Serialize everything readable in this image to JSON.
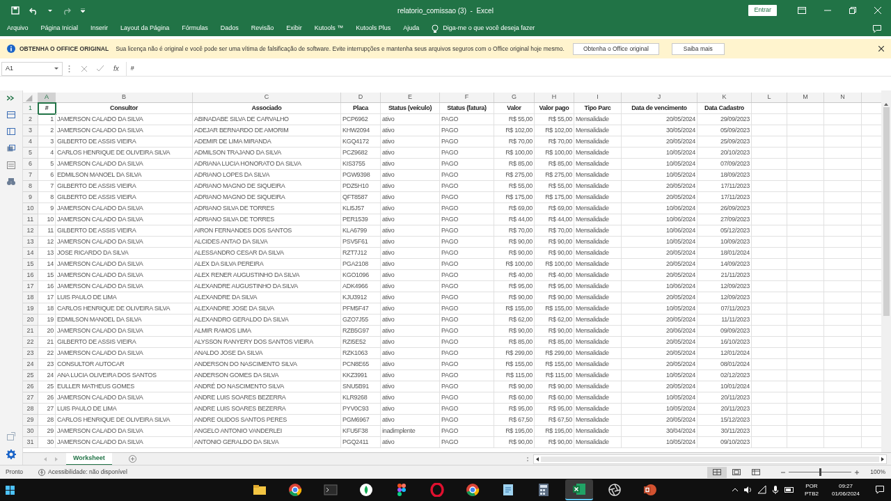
{
  "title_bar": {
    "title": "relatorio_comissao (3)  -  Excel",
    "sign_in": "Entrar"
  },
  "ribbon_tabs": [
    "Arquivo",
    "Página Inicial",
    "Inserir",
    "Layout da Página",
    "Fórmulas",
    "Dados",
    "Revisão",
    "Exibir",
    "Kutools ™",
    "Kutools Plus",
    "Ajuda"
  ],
  "tell_me": "Diga-me o que você deseja fazer",
  "notice": {
    "title": "OBTENHA O OFFICE ORIGINAL",
    "message": "Sua licença não é original e você pode ser uma vítima de falsificação de software. Evite interrupções e mantenha seus arquivos seguros com o Office original hoje mesmo.",
    "buttons": [
      "Obtenha o Office original",
      "Saiba mais"
    ]
  },
  "formula_bar": {
    "name_box": "A1",
    "fx": "fx",
    "content": "#"
  },
  "sheet": {
    "columns": [
      "A",
      "B",
      "C",
      "D",
      "E",
      "F",
      "G",
      "H",
      "I",
      "J",
      "K",
      "L",
      "M",
      "N"
    ],
    "header_row": {
      "number": "1",
      "cells": [
        "#",
        "Consultor",
        "Associado",
        "Placa",
        "Status (veículo)",
        "Status (fatura)",
        "Valor",
        "Valor pago",
        "Tipo Parc",
        "Data de vencimento",
        "Data Cadastro"
      ]
    },
    "rows": [
      {
        "number": "2",
        "cells": [
          "1",
          "JAMERSON CALADO DA SILVA",
          "ABINADABE SILVA DE CARVALHO",
          "PCP6962",
          "ativo",
          "PAGO",
          "R$ 55,00",
          "R$ 55,00",
          "Mensalidade",
          "20/05/2024",
          "29/09/2023"
        ]
      },
      {
        "number": "3",
        "cells": [
          "2",
          "JAMERSON CALADO DA SILVA",
          "ADEJAR BERNARDO DE AMORIM",
          "KHW2094",
          "ativo",
          "PAGO",
          "R$ 102,00",
          "R$ 102,00",
          "Mensalidade",
          "30/05/2024",
          "05/09/2023"
        ]
      },
      {
        "number": "4",
        "cells": [
          "3",
          "GILBERTO DE ASSIS VIEIRA",
          "ADEMIR DE LIMA MIRANDA",
          "KGQ4172",
          "ativo",
          "PAGO",
          "R$ 70,00",
          "R$ 70,00",
          "Mensalidade",
          "20/05/2024",
          "25/09/2023"
        ]
      },
      {
        "number": "5",
        "cells": [
          "4",
          "CARLOS HENRIQUE DE OLIVEIRA SILVA",
          "ADMILSON TRAJANO DA SILVA",
          "PCZ9682",
          "ativo",
          "PAGO",
          "R$ 100,00",
          "R$ 100,00",
          "Mensalidade",
          "10/05/2024",
          "20/10/2023"
        ]
      },
      {
        "number": "6",
        "cells": [
          "5",
          "JAMERSON CALADO DA SILVA",
          "ADRIANA LUCIA HONORATO DA SILVA",
          "KIS3755",
          "ativo",
          "PAGO",
          "R$ 85,00",
          "R$ 85,00",
          "Mensalidade",
          "10/05/2024",
          "07/09/2023"
        ]
      },
      {
        "number": "7",
        "cells": [
          "6",
          "EDMILSON MANOEL DA SILVA",
          "ADRIANO LOPES DA SILVA",
          "PGW9398",
          "ativo",
          "PAGO",
          "R$ 275,00",
          "R$ 275,00",
          "Mensalidade",
          "10/05/2024",
          "18/09/2023"
        ]
      },
      {
        "number": "8",
        "cells": [
          "7",
          "GILBERTO DE ASSIS VIEIRA",
          "ADRIANO MAGNO DE SIQUEIRA",
          "PDZ5H10",
          "ativo",
          "PAGO",
          "R$ 55,00",
          "R$ 55,00",
          "Mensalidade",
          "20/05/2024",
          "17/11/2023"
        ]
      },
      {
        "number": "9",
        "cells": [
          "8",
          "GILBERTO DE ASSIS VIEIRA",
          "ADRIANO MAGNO DE SIQUEIRA",
          "QFT8587",
          "ativo",
          "PAGO",
          "R$ 175,00",
          "R$ 175,00",
          "Mensalidade",
          "20/05/2024",
          "17/11/2023"
        ]
      },
      {
        "number": "10",
        "cells": [
          "9",
          "JAMERSON CALADO DA SILVA",
          "ADRIANO SILVA DE TORRES",
          "KLI5J57",
          "ativo",
          "PAGO",
          "R$ 69,00",
          "R$ 69,00",
          "Mensalidade",
          "10/06/2024",
          "26/09/2023"
        ]
      },
      {
        "number": "11",
        "cells": [
          "10",
          "JAMERSON CALADO DA SILVA",
          "ADRIANO SILVA DE TORRES",
          "PER1539",
          "ativo",
          "PAGO",
          "R$ 44,00",
          "R$ 44,00",
          "Mensalidade",
          "10/06/2024",
          "27/09/2023"
        ]
      },
      {
        "number": "12",
        "cells": [
          "11",
          "GILBERTO DE ASSIS VIEIRA",
          "AIRON FERNANDES DOS SANTOS",
          "KLA6799",
          "ativo",
          "PAGO",
          "R$ 70,00",
          "R$ 70,00",
          "Mensalidade",
          "10/06/2024",
          "05/12/2023"
        ]
      },
      {
        "number": "13",
        "cells": [
          "12",
          "JAMERSON CALADO DA SILVA",
          "ALCIDES ANTAO DA SILVA",
          "PSV5F61",
          "ativo",
          "PAGO",
          "R$ 90,00",
          "R$ 90,00",
          "Mensalidade",
          "10/05/2024",
          "10/09/2023"
        ]
      },
      {
        "number": "14",
        "cells": [
          "13",
          "JOSE RICARDO DA SILVA",
          "ALESSANDRO CESAR DA SILVA",
          "RZT7J12",
          "ativo",
          "PAGO",
          "R$ 90,00",
          "R$ 90,00",
          "Mensalidade",
          "20/05/2024",
          "18/01/2024"
        ]
      },
      {
        "number": "15",
        "cells": [
          "14",
          "JAMERSON CALADO DA SILVA",
          "ALEX DA SILVA PEREIRA",
          "PGA2108",
          "ativo",
          "PAGO",
          "R$ 100,00",
          "R$ 100,00",
          "Mensalidade",
          "20/05/2024",
          "14/09/2023"
        ]
      },
      {
        "number": "16",
        "cells": [
          "15",
          "JAMERSON CALADO DA SILVA",
          "ALEX RENER AUGUSTINHO DA SILVA",
          "KGO1096",
          "ativo",
          "PAGO",
          "R$ 40,00",
          "R$ 40,00",
          "Mensalidade",
          "20/05/2024",
          "21/11/2023"
        ]
      },
      {
        "number": "17",
        "cells": [
          "16",
          "JAMERSON CALADO DA SILVA",
          "ALEXANDRE AUGUSTINHO DA SILVA",
          "ADK4966",
          "ativo",
          "PAGO",
          "R$ 95,00",
          "R$ 95,00",
          "Mensalidade",
          "10/06/2024",
          "12/09/2023"
        ]
      },
      {
        "number": "18",
        "cells": [
          "17",
          "LUIS PAULO DE LIMA",
          "ALEXANDRE DA SILVA",
          "KJU3912",
          "ativo",
          "PAGO",
          "R$ 90,00",
          "R$ 90,00",
          "Mensalidade",
          "20/05/2024",
          "12/09/2023"
        ]
      },
      {
        "number": "19",
        "cells": [
          "18",
          "CARLOS HENRIQUE DE OLIVEIRA SILVA",
          "ALEXANDRE JOSE DA SILVA",
          "PFM5F47",
          "ativo",
          "PAGO",
          "R$ 155,00",
          "R$ 155,00",
          "Mensalidade",
          "10/05/2024",
          "07/11/2023"
        ]
      },
      {
        "number": "20",
        "cells": [
          "19",
          "EDMILSON MANOEL DA SILVA",
          "ALEXANDRO GERALDO DA SILVA",
          "GZO7J55",
          "ativo",
          "PAGO",
          "R$ 62,00",
          "R$ 62,00",
          "Mensalidade",
          "20/05/2024",
          "11/11/2023"
        ]
      },
      {
        "number": "21",
        "cells": [
          "20",
          "JAMERSON CALADO DA SILVA",
          "ALMIR RAMOS LIMA",
          "RZB5G97",
          "ativo",
          "PAGO",
          "R$ 90,00",
          "R$ 90,00",
          "Mensalidade",
          "20/06/2024",
          "09/09/2023"
        ]
      },
      {
        "number": "22",
        "cells": [
          "21",
          "GILBERTO DE ASSIS VIEIRA",
          "ALYSSON RANYERY DOS SANTOS VIEIRA",
          "RZI5E52",
          "ativo",
          "PAGO",
          "R$ 85,00",
          "R$ 85,00",
          "Mensalidade",
          "20/05/2024",
          "16/10/2023"
        ]
      },
      {
        "number": "23",
        "cells": [
          "22",
          "JAMERSON CALADO DA SILVA",
          "ANALDO JOSE DA SILVA",
          "RZK1063",
          "ativo",
          "PAGO",
          "R$ 299,00",
          "R$ 299,00",
          "Mensalidade",
          "20/05/2024",
          "12/01/2024"
        ]
      },
      {
        "number": "24",
        "cells": [
          "23",
          "CONSULTOR AUTOCAR",
          "ANDERSON DO NASCIMENTO SILVA",
          "PCN8E65",
          "ativo",
          "PAGO",
          "R$ 155,00",
          "R$ 155,00",
          "Mensalidade",
          "20/05/2024",
          "08/01/2024"
        ]
      },
      {
        "number": "25",
        "cells": [
          "24",
          "ANA LUCIA OLIVEIRA DOS SANTOS",
          "ANDERSON GOMES DA SILVA",
          "KKZ3991",
          "ativo",
          "PAGO",
          "R$ 115,00",
          "R$ 115,00",
          "Mensalidade",
          "10/05/2024",
          "02/12/2023"
        ]
      },
      {
        "number": "26",
        "cells": [
          "25",
          "EULLER MATHEUS GOMES",
          "ANDRÉ DO NASCIMENTO SILVA",
          "SNU5B91",
          "ativo",
          "PAGO",
          "R$ 90,00",
          "R$ 90,00",
          "Mensalidade",
          "20/05/2024",
          "10/01/2024"
        ]
      },
      {
        "number": "27",
        "cells": [
          "26",
          "JAMERSON CALADO DA SILVA",
          "ANDRE LUIS SOARES BEZERRA",
          "KLR9268",
          "ativo",
          "PAGO",
          "R$ 60,00",
          "R$ 60,00",
          "Mensalidade",
          "10/05/2024",
          "20/11/2023"
        ]
      },
      {
        "number": "28",
        "cells": [
          "27",
          "LUIS PAULO DE LIMA",
          "ANDRE LUIS SOARES BEZERRA",
          "PYV0C93",
          "ativo",
          "PAGO",
          "R$ 95,00",
          "R$ 95,00",
          "Mensalidade",
          "10/05/2024",
          "20/11/2023"
        ]
      },
      {
        "number": "29",
        "cells": [
          "28",
          "CARLOS HENRIQUE DE OLIVEIRA SILVA",
          "ANDRE OLIDOS SANTOS PERES",
          "PGM6967",
          "ativo",
          "PAGO",
          "R$ 67,50",
          "R$ 67,50",
          "Mensalidade",
          "20/05/2024",
          "15/12/2023"
        ]
      },
      {
        "number": "30",
        "cells": [
          "29",
          "JAMERSON CALADO DA SILVA",
          "ANGELO ANTONIO VANDERLEI",
          "KFU5F38",
          "inadimplente",
          "PAGO",
          "R$ 195,00",
          "R$ 195,00",
          "Mensalidade",
          "30/04/2024",
          "30/11/2023"
        ]
      },
      {
        "number": "31",
        "cells": [
          "30",
          "JAMERSON CALADO DA SILVA",
          "ANTONIO GERALDO DA SILVA",
          "PGQ2411",
          "ativo",
          "PAGO",
          "R$ 90,00",
          "R$ 90,00",
          "Mensalidade",
          "10/05/2024",
          "09/10/2023"
        ]
      }
    ]
  },
  "sheet_tabs": [
    {
      "label": "Worksheet",
      "selected": true
    }
  ],
  "status_bar": {
    "ready": "Pronto",
    "accessibility": "Acessibilidade: não disponível",
    "views": [
      {
        "kind": "normal",
        "selected": true
      },
      {
        "kind": "page_layout",
        "selected": false
      },
      {
        "kind": "page_break",
        "selected": false
      }
    ],
    "zoom_slider": {
      "level": 0.5
    },
    "zoom": "100%"
  },
  "taskbar": {
    "apps": [
      {
        "kind": "folder",
        "selected": false
      },
      {
        "kind": "chrome",
        "selected": false
      },
      {
        "kind": "terminal",
        "selected": false
      },
      {
        "kind": "leaf",
        "selected": false
      },
      {
        "kind": "figma",
        "selected": false
      },
      {
        "kind": "opera",
        "selected": false
      },
      {
        "kind": "chrome",
        "selected": false
      },
      {
        "kind": "notepad",
        "selected": false
      },
      {
        "kind": "calculator",
        "selected": false
      },
      {
        "kind": "excel",
        "selected": true
      },
      {
        "kind": "aperture",
        "selected": false
      },
      {
        "kind": "powerpoint",
        "selected": false
      }
    ],
    "language": "POR",
    "layout": "PTB2",
    "time": "09:27",
    "date": "01/06/2024"
  }
}
